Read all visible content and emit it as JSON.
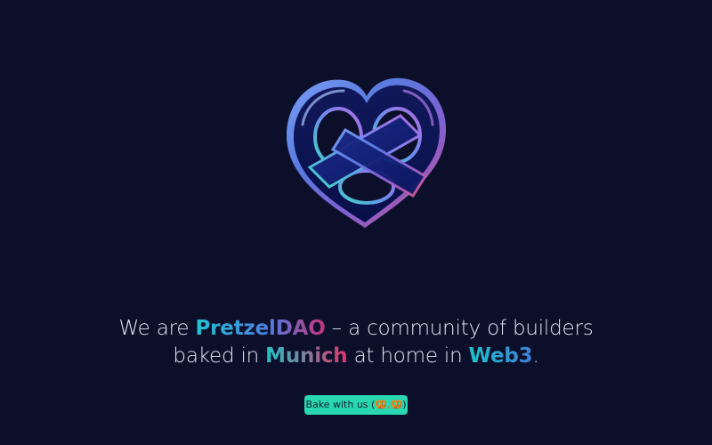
{
  "brand": {
    "logo_icon": "pretzel-logo-icon",
    "colors": {
      "background": "#0c0f2a",
      "teal": "#1ab8c8",
      "pink": "#e2336e",
      "blue": "#3e7ed8",
      "button": "#28d8b0"
    }
  },
  "hero": {
    "line1": {
      "prefix": "We are ",
      "name": "PretzelDAO",
      "suffix": " – a community of builders"
    },
    "line2": {
      "prefix": "baked in ",
      "city": "Munich",
      "middle": " at home in ",
      "web": "Web3",
      "end": "."
    }
  },
  "cta": {
    "label_prefix": "Bake with us (",
    "emoji": "🥨,🥨",
    "label_suffix": ")"
  }
}
